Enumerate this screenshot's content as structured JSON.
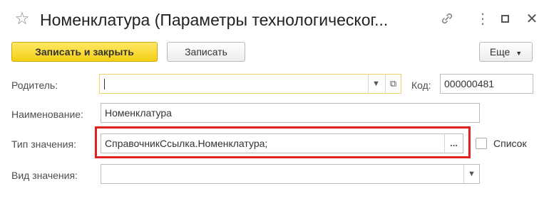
{
  "window": {
    "title": "Номенклатура (Параметры технологическог...",
    "icons": {
      "favorite": "star-icon",
      "link": "link-icon",
      "more": "more-icon",
      "maximize": "maximize-icon",
      "close": "close-icon"
    }
  },
  "toolbar": {
    "save_close_label": "Записать и закрыть",
    "save_label": "Записать",
    "more_label": "Еще"
  },
  "form": {
    "parent": {
      "label": "Родитель:",
      "value": ""
    },
    "code": {
      "label": "Код:",
      "value": "000000481"
    },
    "name": {
      "label": "Наименование:",
      "value": "Номенклатура"
    },
    "value_type": {
      "label": "Тип значения:",
      "value": "СправочникСсылка.Номенклатура;",
      "ellipsis": "..."
    },
    "list_checkbox": {
      "label": "Список",
      "checked": false
    },
    "value_kind": {
      "label": "Вид значения:",
      "value": ""
    }
  },
  "colors": {
    "primary_button": "#f4cf14",
    "highlight_frame": "#e0211f"
  }
}
